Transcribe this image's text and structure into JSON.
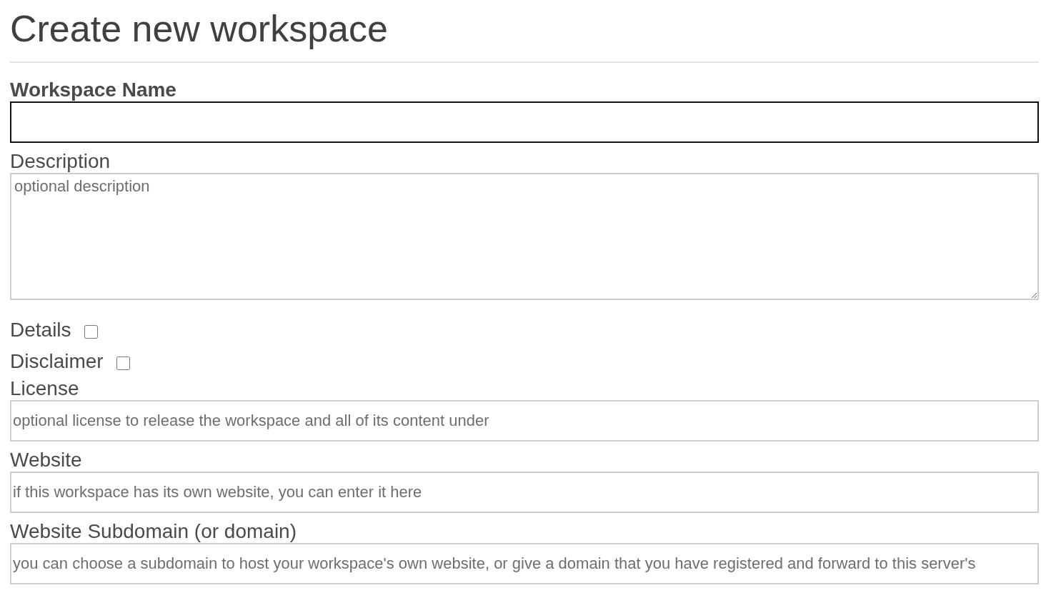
{
  "page": {
    "title": "Create new workspace"
  },
  "fields": [
    {
      "kind": "text",
      "label": "Workspace Name",
      "required": true,
      "focused": true
    },
    {
      "kind": "textarea",
      "label": "Description",
      "required": false,
      "placeholder": "optional description",
      "focused": false
    },
    {
      "kind": "checkbox",
      "label": "Details",
      "checked": false
    },
    {
      "kind": "checkbox",
      "label": "Disclaimer",
      "checked": false
    },
    {
      "kind": "text",
      "label": "License",
      "required": false,
      "placeholder": "optional license to release the workspace and all of its content under",
      "focused": false
    },
    {
      "kind": "text",
      "label": "Website",
      "required": false,
      "placeholder": "if this workspace has its own website, you can enter it here",
      "focused": false
    },
    {
      "kind": "text",
      "label": "Website Subdomain (or domain)",
      "required": false,
      "placeholder": "you can choose a subdomain to host your workspace's own website, or give a domain that you have registered and forward to this server's",
      "focused": false
    }
  ]
}
